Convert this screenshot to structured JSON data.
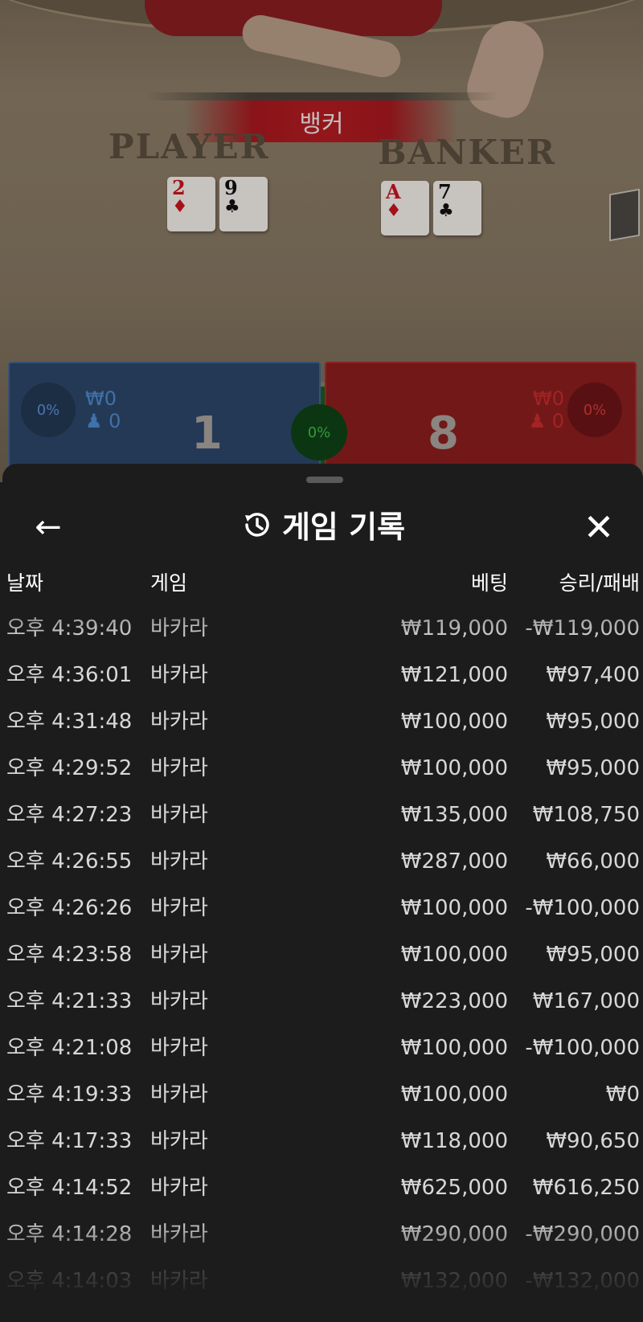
{
  "game_view": {
    "result_banner": "뱅커",
    "player_label": "PLAYER",
    "banker_label": "BANKER",
    "player_cards": [
      {
        "rank": "2",
        "suit": "♦",
        "color": "red"
      },
      {
        "rank": "9",
        "suit": "♣",
        "color": "black"
      }
    ],
    "banker_cards": [
      {
        "rank": "A",
        "suit": "♦",
        "color": "red"
      },
      {
        "rank": "7",
        "suit": "♣",
        "color": "black"
      }
    ],
    "player_zone": {
      "percent": "0%",
      "amount": "₩0",
      "bettors": "0",
      "score": "1",
      "color": "#2c4668"
    },
    "banker_zone": {
      "percent": "0%",
      "amount": "₩0",
      "bettors": "0",
      "score": "8",
      "color": "#8c1e1f"
    },
    "tie_zone": {
      "percent": "0%",
      "color": "#175d21"
    }
  },
  "history": {
    "title": "게임 기록",
    "back_icon": "arrow-left-icon",
    "history_icon": "history-clock-icon",
    "close_icon": "close-icon",
    "columns": {
      "date": "날짜",
      "game": "게임",
      "bet": "베팅",
      "win_loss": "승리/패배"
    },
    "rows": [
      {
        "date": "오후 4:39:40",
        "game": "바카라",
        "bet": "₩119,000",
        "win_loss": "-₩119,000"
      },
      {
        "date": "오후 4:36:01",
        "game": "바카라",
        "bet": "₩121,000",
        "win_loss": "₩97,400"
      },
      {
        "date": "오후 4:31:48",
        "game": "바카라",
        "bet": "₩100,000",
        "win_loss": "₩95,000"
      },
      {
        "date": "오후 4:29:52",
        "game": "바카라",
        "bet": "₩100,000",
        "win_loss": "₩95,000"
      },
      {
        "date": "오후 4:27:23",
        "game": "바카라",
        "bet": "₩135,000",
        "win_loss": "₩108,750"
      },
      {
        "date": "오후 4:26:55",
        "game": "바카라",
        "bet": "₩287,000",
        "win_loss": "₩66,000"
      },
      {
        "date": "오후 4:26:26",
        "game": "바카라",
        "bet": "₩100,000",
        "win_loss": "-₩100,000"
      },
      {
        "date": "오후 4:23:58",
        "game": "바카라",
        "bet": "₩100,000",
        "win_loss": "₩95,000"
      },
      {
        "date": "오후 4:21:33",
        "game": "바카라",
        "bet": "₩223,000",
        "win_loss": "₩167,000"
      },
      {
        "date": "오후 4:21:08",
        "game": "바카라",
        "bet": "₩100,000",
        "win_loss": "-₩100,000"
      },
      {
        "date": "오후 4:19:33",
        "game": "바카라",
        "bet": "₩100,000",
        "win_loss": "₩0"
      },
      {
        "date": "오후 4:17:33",
        "game": "바카라",
        "bet": "₩118,000",
        "win_loss": "₩90,650"
      },
      {
        "date": "오후 4:14:52",
        "game": "바카라",
        "bet": "₩625,000",
        "win_loss": "₩616,250"
      },
      {
        "date": "오후 4:14:28",
        "game": "바카라",
        "bet": "₩290,000",
        "win_loss": "-₩290,000"
      },
      {
        "date": "오후 4:14:03",
        "game": "바카라",
        "bet": "₩132,000",
        "win_loss": "-₩132,000"
      }
    ]
  }
}
